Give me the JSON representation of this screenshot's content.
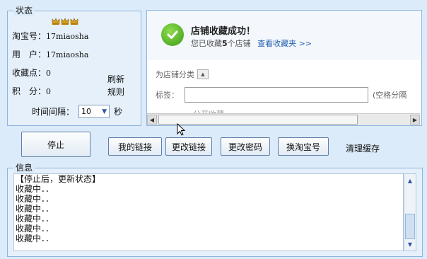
{
  "status": {
    "title": "状态",
    "username_label": "淘宝号：",
    "username_value": "17miaosha",
    "user_label": "用　户：",
    "user_value": "17miaosha",
    "points_label": "收藏点：",
    "points_value": "0",
    "score_label": "积　分：",
    "score_value": "0",
    "refresh_label": "刷新",
    "rules_label": "规则",
    "interval_label": "时间间隔：",
    "interval_value": "10",
    "interval_unit": "秒"
  },
  "browser": {
    "success_title": "店铺收藏成功！",
    "success_prefix": "您已收藏",
    "success_count": "5",
    "success_suffix": "个店铺",
    "view_link": "查看收藏夹 >>",
    "category_label": "为店铺分类",
    "tag_label": "标签：",
    "tag_value": "",
    "tag_hint": "(空格分隔",
    "partial_text": "…公开收藏"
  },
  "toolbar": {
    "stop_label": "停止",
    "my_links_label": "我的链接",
    "change_link_label": "更改链接",
    "change_password_label": "更改密码",
    "switch_account_label": "换淘宝号",
    "clear_cache_label": "清理缓存"
  },
  "info": {
    "title": "信息",
    "log_lines": [
      "【停止后，更新状态】",
      "收藏中．．",
      "收藏中．．",
      "收藏中．．",
      "收藏中．．",
      "收藏中．．",
      "收藏中．．"
    ]
  },
  "icons": {
    "crown_color": "#d9a21b",
    "success_color": "#4caf1f"
  }
}
